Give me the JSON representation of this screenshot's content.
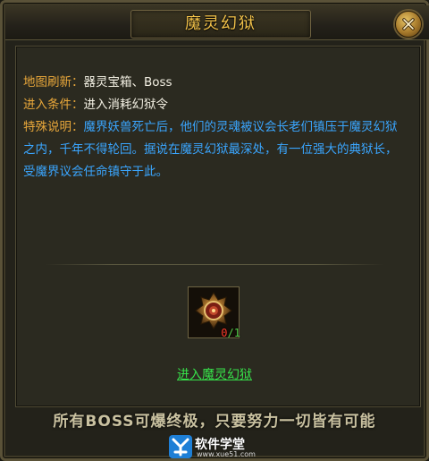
{
  "dialog": {
    "title": "魔灵幻狱",
    "close_icon": "close-icon"
  },
  "info": {
    "refresh_label": "地图刷新：",
    "refresh_value": "器灵宝箱、Boss",
    "condition_label": "进入条件：",
    "condition_value": "进入消耗幻狱令",
    "special_label": "特殊说明：",
    "special_value": "魔界妖兽死亡后，他们的灵魂被议会长老们镇压于魔灵幻狱之内，千年不得轮回。据说在魔灵幻狱最深处，有一位强大的典狱长，受魔界议会任命镇守于此。"
  },
  "item": {
    "icon": "token-icon",
    "have": "0",
    "sep": "/",
    "need": "1"
  },
  "enter_link": "进入魔灵幻狱",
  "footer": "所有BOSS可爆终极，只要努力一切皆有可能",
  "watermark": {
    "name": "软件学堂",
    "url": "www.xue51.com"
  },
  "colors": {
    "title": "#f2c24a",
    "label": "#e8a73a",
    "value": "#f2efe2",
    "description": "#3aa6ff",
    "link": "#37e14a",
    "count_have": "#ff3a2a",
    "count_need": "#55d14a"
  }
}
